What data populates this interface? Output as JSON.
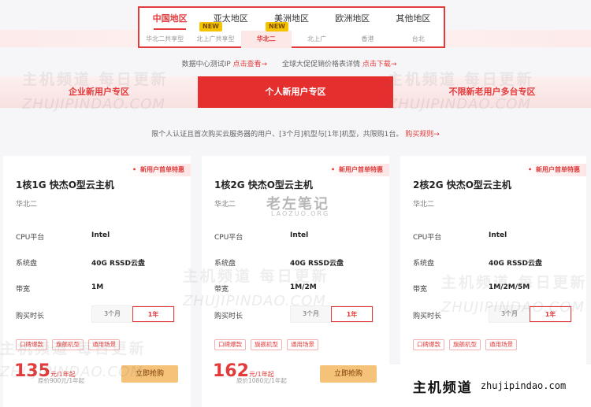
{
  "regions": [
    "中国地区",
    "亚太地区",
    "美洲地区",
    "欧洲地区",
    "其他地区"
  ],
  "active_region": 0,
  "subregions": [
    "华北二共享型",
    "北上广共享型",
    "华北二",
    "北上广",
    "香港",
    "台北"
  ],
  "active_subregion": 2,
  "new_badge": "NEW",
  "info": {
    "text1": "数据中心测试IP",
    "link1": "点击查看→",
    "text2": "全球大促促销价格表详情",
    "link2": "点击下载→"
  },
  "zones": [
    "企业新用户专区",
    "个人新用户专区",
    "不限新老用户多台专区"
  ],
  "active_zone": 1,
  "desc": {
    "text": "限个人认证且首次购买云服务器的用户、[3个月]机型与[1年]机型，共限购1台。",
    "link": "购买规则→"
  },
  "cards": [
    {
      "tag": "新用户首单特惠",
      "name": "1核1G 快杰O型云主机",
      "zone": "华北二",
      "cpu_label": "CPU平台",
      "cpu": "Intel",
      "disk_label": "系统盘",
      "disk": "40G RSSD云盘",
      "bw_label": "带宽",
      "bw": "1M",
      "dur_label": "购买时长",
      "dur_opt1": "3个月",
      "dur_opt2": "1年",
      "chip1": "口碑爆款",
      "chip2": "旗舰机型",
      "chip3": "通用场景",
      "price": "135",
      "price_unit": "元/1年起",
      "orig": "原价900元/1年起",
      "buy": "立即抢购"
    },
    {
      "tag": "新用户首单特惠",
      "name": "1核2G 快杰O型云主机",
      "zone": "华北二",
      "cpu_label": "CPU平台",
      "cpu": "Intel",
      "disk_label": "系统盘",
      "disk": "40G RSSD云盘",
      "bw_label": "带宽",
      "bw": "1M/2M",
      "dur_label": "购买时长",
      "dur_opt1": "3个月",
      "dur_opt2": "1年",
      "chip1": "口碑爆款",
      "chip2": "旗舰机型",
      "chip3": "通用场景",
      "price": "162",
      "price_unit": "元/1年起",
      "orig": "原价1080元/1年起",
      "buy": "立即抢购"
    },
    {
      "tag": "新用户首单特惠",
      "name": "2核2G 快杰O型云主机",
      "zone": "华北二",
      "cpu_label": "CPU平台",
      "cpu": "Intel",
      "disk_label": "系统盘",
      "disk": "40G RSSD云盘",
      "bw_label": "带宽",
      "bw": "1M/2M/5M",
      "dur_label": "购买时长",
      "dur_opt1": "3个月",
      "dur_opt2": "1年",
      "chip1": "口碑爆款",
      "chip2": "旗舰机型",
      "chip3": "通用场景"
    }
  ],
  "watermark": {
    "cn": "主机频道 每日更新",
    "en": "ZHUJIPINDAO.COM",
    "laozuo": "老左笔记",
    "laozuo_sub": "LAOZUO.ORG"
  },
  "footer": {
    "cn": "主机频道",
    "en": "zhujipindao.com"
  },
  "colors": {
    "accent": "#e33b3b",
    "buy": "#f5c27a",
    "badge": "#f5c400"
  }
}
